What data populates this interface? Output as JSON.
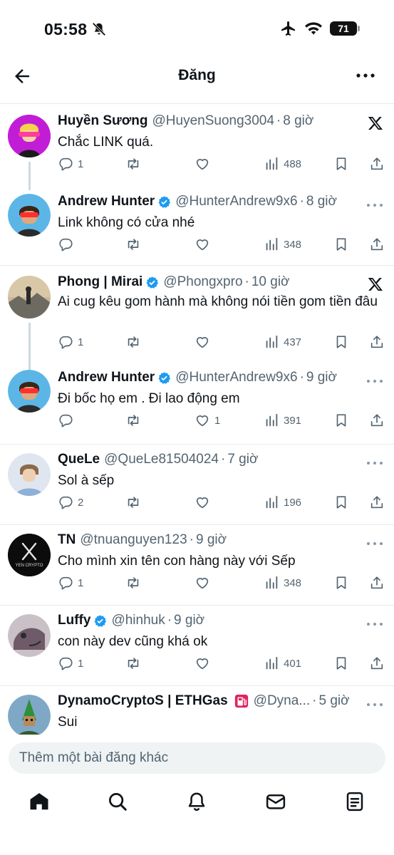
{
  "status": {
    "time": "05:58",
    "battery": "71"
  },
  "header": {
    "title": "Đăng"
  },
  "posts": [
    {
      "name": "Huyền Sương",
      "handle": "@HuyenSuong3004",
      "time": "8 giờ",
      "text": "Chắc LINK quá.",
      "replies": "1",
      "likes": "",
      "views": "488",
      "verified": false,
      "badge": "x-logo",
      "avatar_color": "#c21dd6"
    },
    {
      "name": "Andrew Hunter",
      "handle": "@HunterAndrew9x6",
      "time": "8 giờ",
      "text": "Link không có cửa nhé",
      "replies": "",
      "likes": "",
      "views": "348",
      "verified": true,
      "badge": "more-icon",
      "avatar_color": "#5bb6e6"
    },
    {
      "name": "Phong | Mirai",
      "handle": "@Phongxpro",
      "time": "10 giờ",
      "text": "Ai cug kêu gom hành mà không nói tiền gom tiền đâu",
      "replies": "1",
      "likes": "",
      "views": "437",
      "verified": true,
      "badge": "x-logo",
      "avatar_color": "#6d6a62"
    },
    {
      "name": "Andrew Hunter",
      "handle": "@HunterAndrew9x6",
      "time": "9 giờ",
      "text": "Đi bốc họ em . Đi lao động em",
      "replies": "",
      "likes": "1",
      "views": "391",
      "verified": true,
      "badge": "more-icon",
      "avatar_color": "#5bb6e6"
    },
    {
      "name": "QueLe",
      "handle": "@QueLe81504024",
      "time": "7 giờ",
      "text": "Sol à sếp",
      "replies": "2",
      "likes": "",
      "views": "196",
      "verified": false,
      "badge": "more-icon",
      "avatar_color": "#8fb0d8"
    },
    {
      "name": "TN",
      "handle": "@tnuanguyen123",
      "time": "9 giờ",
      "text": "Cho mình xin tên con hàng này với Sếp",
      "replies": "1",
      "likes": "",
      "views": "348",
      "verified": false,
      "badge": "more-icon",
      "avatar_color": "#0c0c0c",
      "avatar_text": "YEN CRYPTO"
    },
    {
      "name": "Luffy",
      "handle": "@hinhuk",
      "time": "9 giờ",
      "text": "con này dev cũng khá ok",
      "replies": "1",
      "likes": "",
      "views": "401",
      "verified": true,
      "badge": "more-icon",
      "avatar_color": "#6f5a6a"
    },
    {
      "name": "DynamoCryptoS | ETHGas",
      "handle": "@Dyna...",
      "time": "5 giờ",
      "text": "Sui",
      "verified": false,
      "badge": "more-icon",
      "avatar_color": "#2f8f3a"
    }
  ],
  "composer": {
    "placeholder": "Thêm một bài đăng khác"
  },
  "nav": [
    "home-icon",
    "search-icon",
    "notifications-icon",
    "messages-icon",
    "lists-icon"
  ],
  "colors": {
    "verified_blue": "#1d9bf0",
    "muted_text": "#536471",
    "divider": "#e6ebee"
  }
}
